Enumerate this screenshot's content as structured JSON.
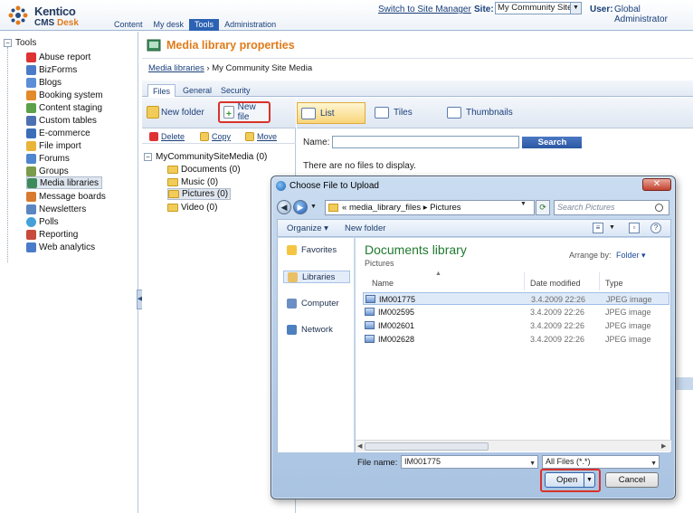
{
  "brand": {
    "name": "Kentico",
    "sub_cms": "CMS",
    "sub_desk": "Desk"
  },
  "header": {
    "switch_link": "Switch to Site Manager",
    "site_label": "Site:",
    "site_value": "My Community Site",
    "user_label": "User:",
    "user_value": "Global Administrator"
  },
  "main_tabs": [
    "Content",
    "My desk",
    "Tools",
    "Administration"
  ],
  "sidebar": {
    "root": "Tools",
    "items": [
      "Abuse report",
      "BizForms",
      "Blogs",
      "Booking system",
      "Content staging",
      "Custom tables",
      "E-commerce",
      "File import",
      "Forums",
      "Groups",
      "Media libraries",
      "Message boards",
      "Newsletters",
      "Polls",
      "Reporting",
      "Web analytics"
    ],
    "selected": "Media libraries"
  },
  "content": {
    "title": "Media library properties",
    "breadcrumb_link": "Media libraries",
    "breadcrumb_current": "My Community Site Media",
    "sub_tabs": [
      "Files",
      "General",
      "Security"
    ],
    "new_folder": "New folder",
    "new_file": "New file",
    "actions": [
      "Delete",
      "Copy",
      "Move"
    ],
    "tree": {
      "root": "MyCommunitySiteMedia (0)",
      "folders": [
        "Documents (0)",
        "Music (0)",
        "Pictures (0)",
        "Video (0)"
      ],
      "selected": "Pictures (0)"
    },
    "views": [
      "List",
      "Tiles",
      "Thumbnails"
    ],
    "name_label": "Name:",
    "search_label": "Search",
    "empty_message": "There are no files to display."
  },
  "dialog": {
    "title": "Choose File to Upload",
    "address_prefix": "«",
    "address_path": [
      "media_library_files",
      "Pictures"
    ],
    "search_placeholder": "Search Pictures",
    "organize": "Organize ▾",
    "new_folder": "New folder",
    "nav": [
      "Favorites",
      "Libraries",
      "Computer",
      "Network"
    ],
    "nav_selected": "Libraries",
    "library_title": "Documents library",
    "library_sub": "Pictures",
    "arrange_label": "Arrange by:",
    "arrange_value": "Folder ▾",
    "columns": [
      "Name",
      "Date modified",
      "Type"
    ],
    "files": [
      {
        "name": "IM001775",
        "date": "3.4.2009 22:26",
        "type": "JPEG image"
      },
      {
        "name": "IM002595",
        "date": "3.4.2009 22:26",
        "type": "JPEG image"
      },
      {
        "name": "IM002601",
        "date": "3.4.2009 22:26",
        "type": "JPEG image"
      },
      {
        "name": "IM002628",
        "date": "3.4.2009 22:26",
        "type": "JPEG image"
      }
    ],
    "selected_file": "IM001775",
    "file_name_label": "File name:",
    "file_name_value": "IM001775",
    "file_type": "All Files (*.*)",
    "open_label": "Open",
    "cancel_label": "Cancel"
  },
  "colors": {
    "accent_orange": "#e07b1a",
    "nav_blue": "#1a3f7a",
    "highlight_red": "#d9322a",
    "library_green": "#1f7a2f"
  }
}
